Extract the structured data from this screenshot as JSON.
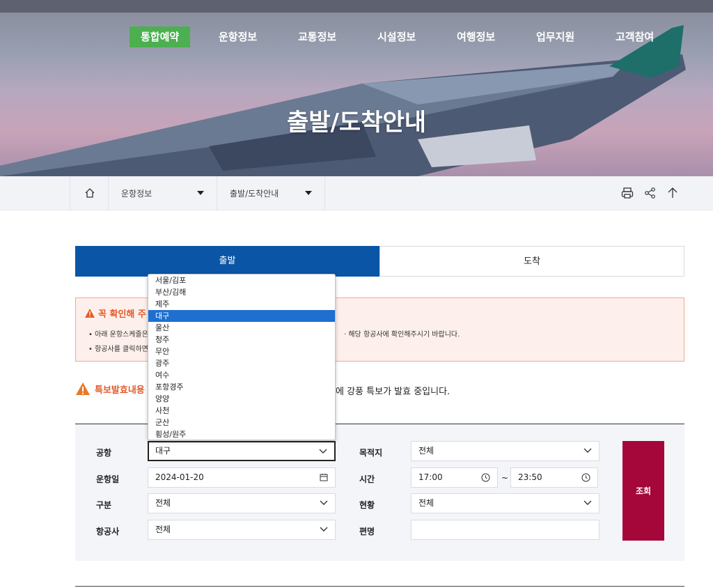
{
  "nav": {
    "items": [
      "통합예약",
      "운항정보",
      "교통정보",
      "시설정보",
      "여행정보",
      "업무지원",
      "고객참여"
    ],
    "active_color": "#4caf50"
  },
  "hero": {
    "title": "출발/도착안내"
  },
  "breadcrumb": {
    "home_icon": "home-icon",
    "level1": "운항정보",
    "level2": "출발/도착안내",
    "tools": [
      "print-icon",
      "share-icon",
      "arrow-up-icon"
    ]
  },
  "tabs": {
    "departure": "출발",
    "arrival": "도착",
    "active_color": "#0a55a5"
  },
  "notice": {
    "title": "꼭 확인해 주",
    "items": [
      "아래 운항스케줄은",
      "항공사를 클릭하면"
    ],
    "item1_tail": "해당 항공사에 확인해주시기 바랍니다."
  },
  "warning": {
    "label": "특보발효내용",
    "message": "에 강풍 특보가 발효 중입니다."
  },
  "search": {
    "airport_label": "공항",
    "airport_value": "대구",
    "destination_label": "목적지",
    "destination_value": "전체",
    "date_label": "운항일",
    "date_value": "2024-01-20",
    "time_label": "시간",
    "time_from": "17:00",
    "time_sep": "~",
    "time_to": "23:50",
    "type_label": "구분",
    "type_value": "전체",
    "status_label": "현황",
    "status_value": "전체",
    "airline_label": "항공사",
    "airline_value": "전체",
    "flight_label": "편명",
    "flight_value": "",
    "submit_label": "조회",
    "submit_color": "#a5073a"
  },
  "airport_dropdown": {
    "options": [
      "서울/김포",
      "부산/김해",
      "제주",
      "대구",
      "울산",
      "청주",
      "무안",
      "광주",
      "여수",
      "포항경주",
      "양양",
      "사천",
      "군산",
      "횡성/원주"
    ],
    "selected": "대구"
  }
}
